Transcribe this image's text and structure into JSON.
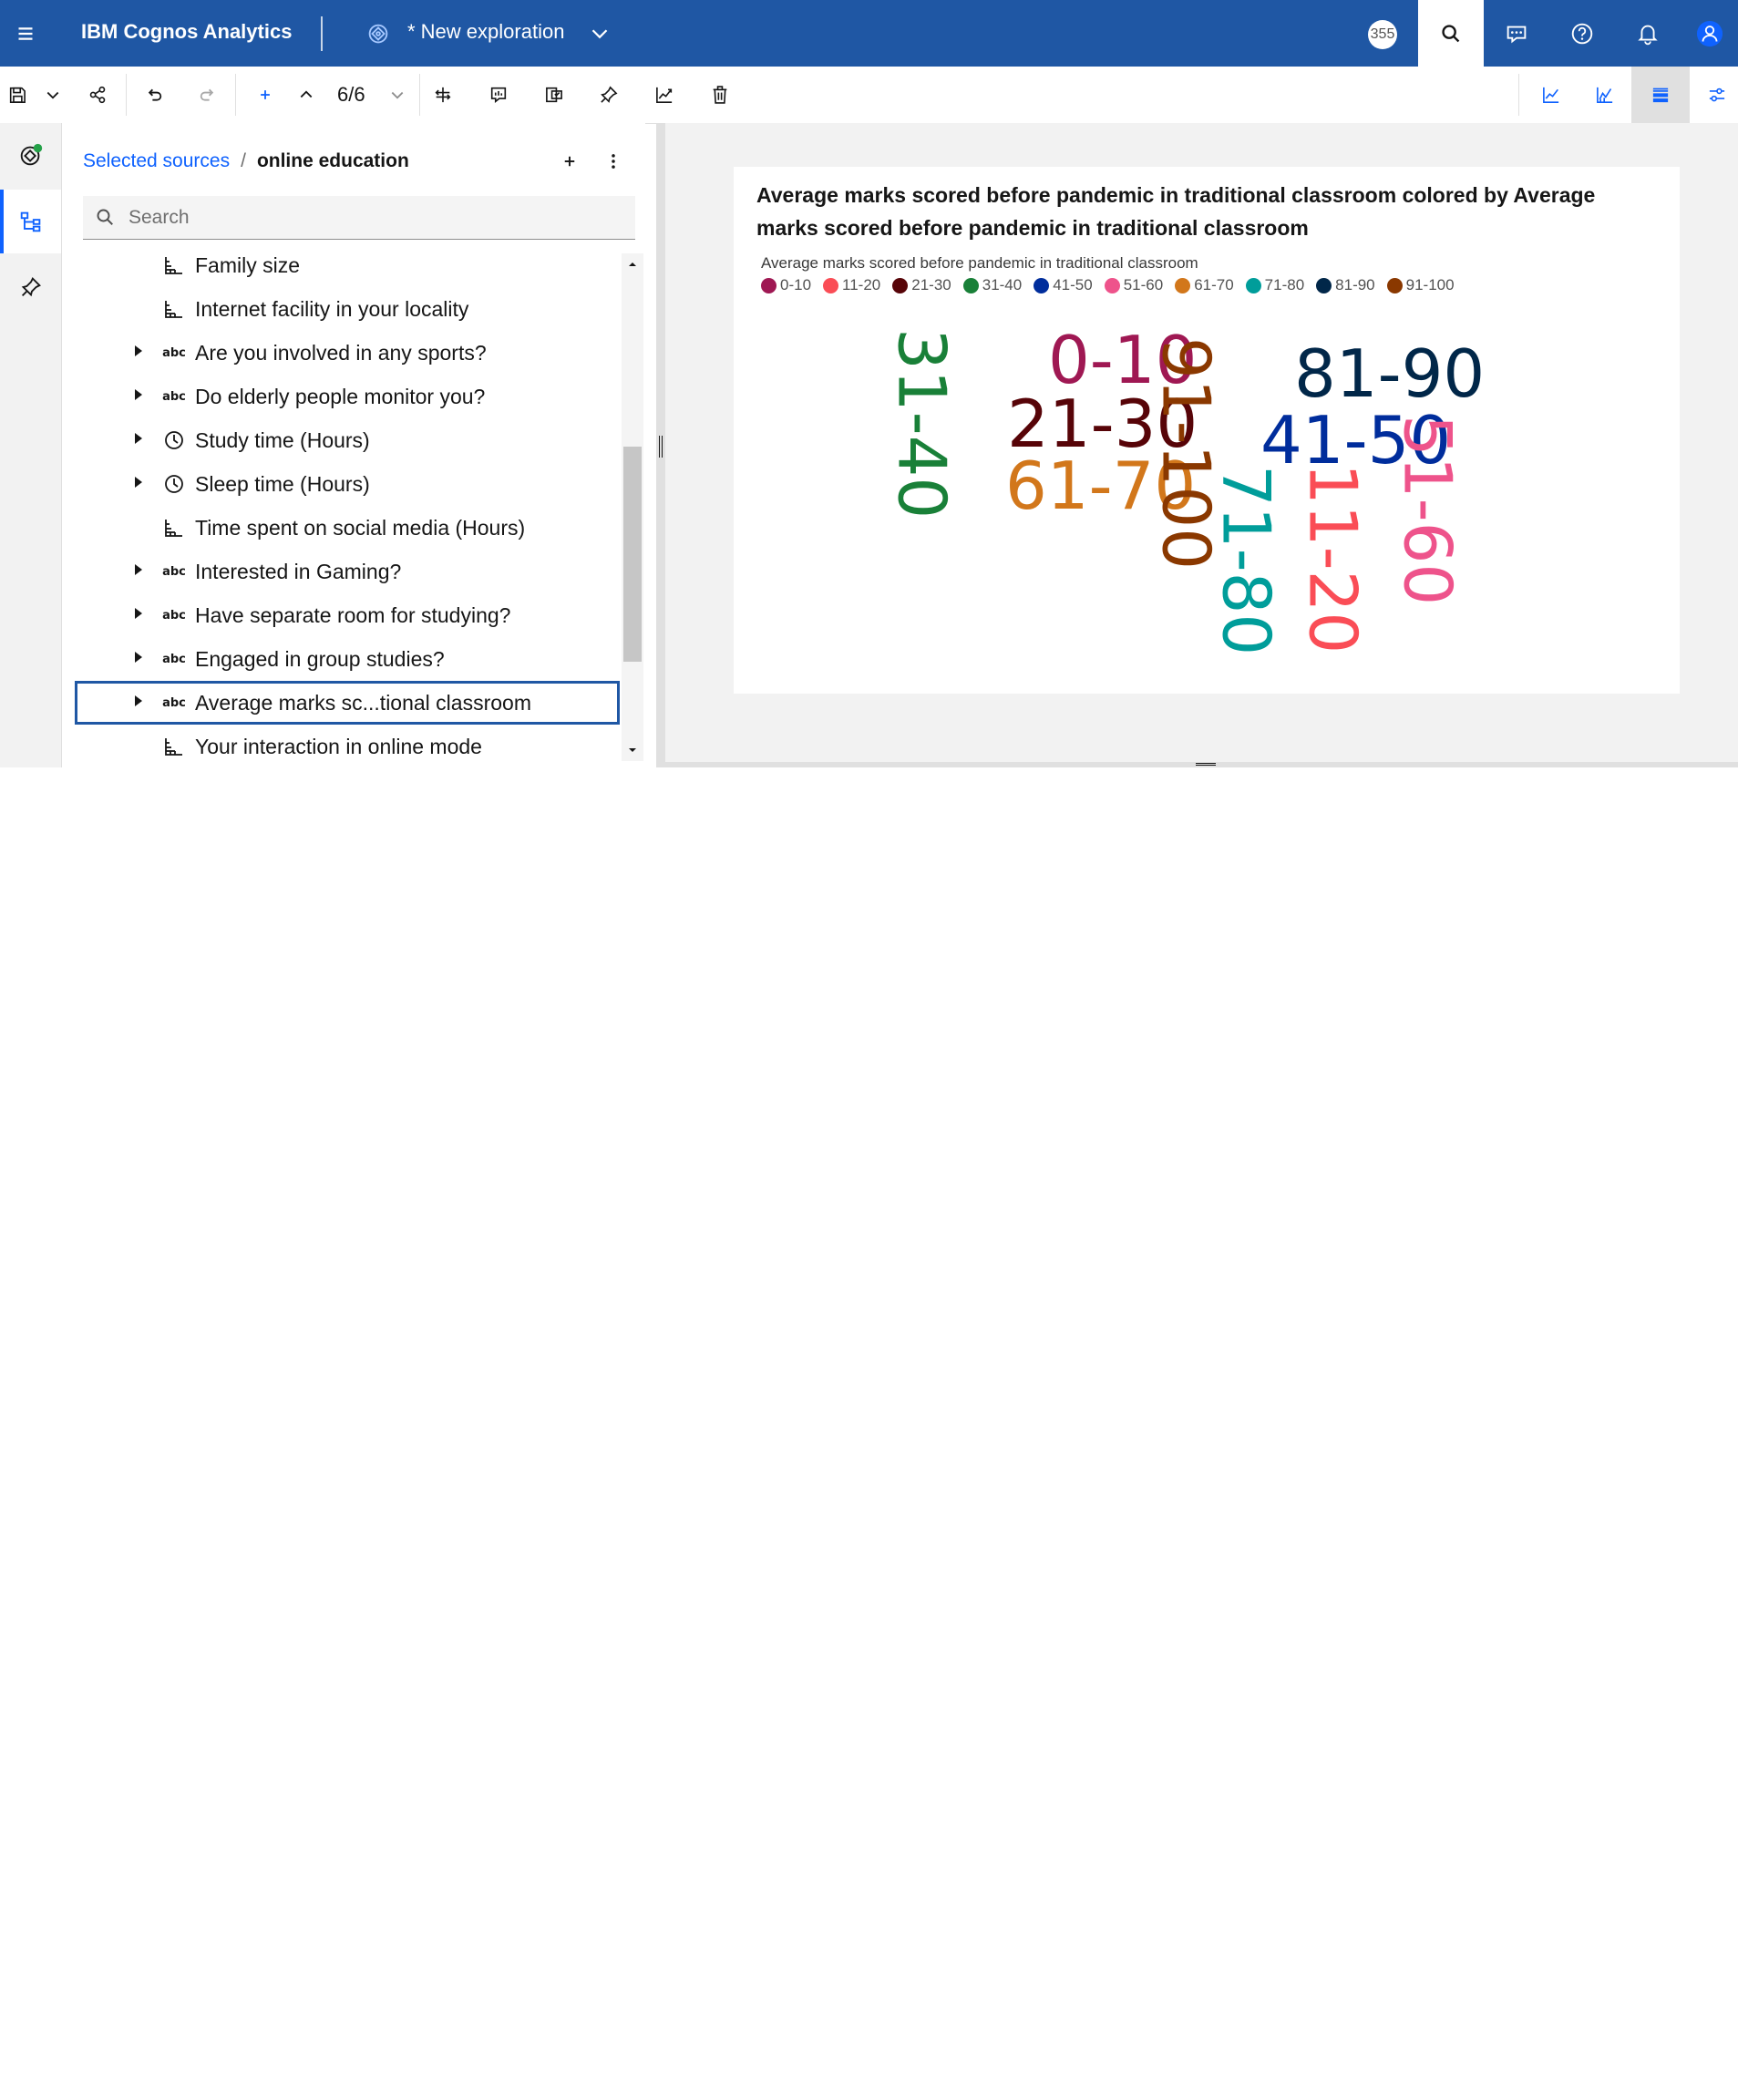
{
  "header": {
    "app_title": "IBM Cognos Analytics",
    "exploration_title": "* New exploration",
    "badge": "355",
    "colors": {
      "bar": "#1f57a4",
      "accent": "#0f62fe"
    }
  },
  "toolbar": {
    "page_counter": "6/6"
  },
  "source_panel": {
    "breadcrumb_link": "Selected sources",
    "breadcrumb_separator": "/",
    "breadcrumb_current": "online education",
    "search_placeholder": "Search",
    "items": [
      {
        "label": "Family size",
        "type": "measure",
        "expandable": false
      },
      {
        "label": "Internet facility in your locality",
        "type": "measure",
        "expandable": false
      },
      {
        "label": "Are you involved in any sports?",
        "type": "abc",
        "expandable": true
      },
      {
        "label": "Do elderly people monitor you?",
        "type": "abc",
        "expandable": true
      },
      {
        "label": "Study time (Hours)",
        "type": "time",
        "expandable": true
      },
      {
        "label": "Sleep time (Hours)",
        "type": "time",
        "expandable": true
      },
      {
        "label": "Time spent on social media (Hours)",
        "type": "measure",
        "expandable": false
      },
      {
        "label": "Interested in Gaming?",
        "type": "abc",
        "expandable": true
      },
      {
        "label": "Have separate room for studying?",
        "type": "abc",
        "expandable": true
      },
      {
        "label": "Engaged in group studies?",
        "type": "abc",
        "expandable": true
      },
      {
        "label": "Average marks sc...tional classroom",
        "type": "abc",
        "expandable": true,
        "selected": true
      },
      {
        "label": "Your interaction in online mode",
        "type": "measure",
        "expandable": false
      }
    ],
    "type_abc_text": "abc"
  },
  "chart_data": {
    "type": "word-cloud",
    "title": "Average marks scored before pandemic in traditional classroom colored by Average marks scored before pandemic in traditional classroom",
    "legend_title": "Average marks scored before pandemic in traditional classroom",
    "legend": [
      {
        "label": "0-10",
        "color": "#9f1853"
      },
      {
        "label": "11-20",
        "color": "#fa4d56"
      },
      {
        "label": "21-30",
        "color": "#570408"
      },
      {
        "label": "31-40",
        "color": "#198038"
      },
      {
        "label": "41-50",
        "color": "#002d9c"
      },
      {
        "label": "51-60",
        "color": "#ee538b"
      },
      {
        "label": "61-70",
        "color": "#d2771b"
      },
      {
        "label": "71-80",
        "color": "#009d9a"
      },
      {
        "label": "81-90",
        "color": "#012749"
      },
      {
        "label": "91-100",
        "color": "#8a3800"
      }
    ],
    "words": [
      {
        "text": "0-10",
        "color": "#9f1853",
        "orientation": "horizontal"
      },
      {
        "text": "21-30",
        "color": "#570408",
        "orientation": "horizontal"
      },
      {
        "text": "61-70",
        "color": "#d2771b",
        "orientation": "horizontal"
      },
      {
        "text": "81-90",
        "color": "#012749",
        "orientation": "horizontal"
      },
      {
        "text": "41-50",
        "color": "#002d9c",
        "orientation": "horizontal"
      },
      {
        "text": "31-40",
        "color": "#198038",
        "orientation": "vertical"
      },
      {
        "text": "91-100",
        "color": "#8a3800",
        "orientation": "vertical"
      },
      {
        "text": "71-80",
        "color": "#009d9a",
        "orientation": "vertical"
      },
      {
        "text": "11-20",
        "color": "#fa4d56",
        "orientation": "vertical"
      },
      {
        "text": "51-60",
        "color": "#ee538b",
        "orientation": "vertical"
      }
    ]
  }
}
